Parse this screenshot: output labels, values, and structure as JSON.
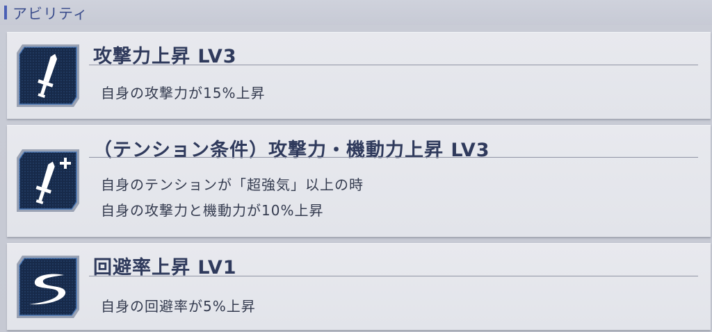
{
  "header": {
    "title": "アビリティ"
  },
  "abilities": [
    {
      "icon": "sword-icon",
      "title": "攻撃力上昇 LV3",
      "desc": [
        "自身の攻撃力が15%上昇"
      ]
    },
    {
      "icon": "sword-plus-icon",
      "title": "（テンション条件）攻撃力・機動力上昇 LV3",
      "desc": [
        "自身のテンションが「超強気」以上の時",
        "自身の攻撃力と機動力が10%上昇"
      ]
    },
    {
      "icon": "evasion-swoosh-icon",
      "title": "回避率上昇 LV1",
      "desc": [
        "自身の回避率が5%上昇"
      ]
    }
  ],
  "colors": {
    "accent": "#4a5fb5",
    "icon_bg": "#1a2e52",
    "icon_border": "#3c5a8a"
  }
}
